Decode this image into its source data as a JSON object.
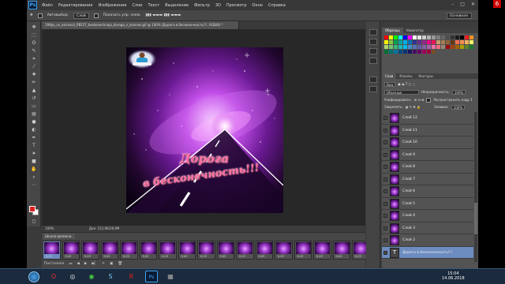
{
  "menubar": {
    "logo": "Ps",
    "items": [
      "Файл",
      "Редактирование",
      "Изображение",
      "Слои",
      "Текст",
      "Выделение",
      "Фильтр",
      "3D",
      "Просмотр",
      "Окно",
      "Справка"
    ],
    "window_controls": [
      "–",
      "□",
      "✕"
    ]
  },
  "options": {
    "autoselect_label": "Автовыбор:",
    "autoselect_value": "Слой",
    "show_controls_label": "Показать упр. элем.",
    "workspace": "Основная"
  },
  "document": {
    "tab_title": "199px_ns_animacii_PB157_beskonechnaja_doroga_v_kosmos.gif @ 100% (Дорога в бесконечность!!!, RGB/8) *",
    "status_zoom": "100%",
    "status_doc": "Док: 512,9K/26,9M"
  },
  "artwork": {
    "line1": "Дорога",
    "line2": "в бесконечность!!!"
  },
  "timeline": {
    "title": "Шкала времени",
    "frame_delay": "0,03",
    "frames": [
      1,
      2,
      3,
      4,
      5,
      6,
      7,
      8,
      9,
      10,
      11,
      12,
      13,
      14,
      15,
      16,
      17
    ],
    "selected_frame": 1,
    "loop": "Постоянно"
  },
  "right_panels": {
    "top_tabs": [
      "Образцы",
      "Навигатор"
    ],
    "layers_tabs": [
      "Слои",
      "Каналы",
      "Контуры"
    ],
    "filter_label": "Вид",
    "blend_mode": "Обычные",
    "opacity_label": "Непрозрачность:",
    "opacity_value": "100%",
    "unify_label": "Унифицировать:",
    "propagate_label": "Распространить кадр 1",
    "lock_label": "Закрепить:",
    "fill_label": "Заливка:",
    "fill_value": "100%",
    "layers": [
      {
        "name": "Слой 12",
        "type": "image"
      },
      {
        "name": "Слой 11",
        "type": "image"
      },
      {
        "name": "Слой 10",
        "type": "image"
      },
      {
        "name": "Слой 9",
        "type": "image"
      },
      {
        "name": "Слой 8",
        "type": "image"
      },
      {
        "name": "Слой 7",
        "type": "image"
      },
      {
        "name": "Слой 6",
        "type": "image"
      },
      {
        "name": "Слой 5",
        "type": "image"
      },
      {
        "name": "Слой 4",
        "type": "image"
      },
      {
        "name": "Слой 3",
        "type": "image"
      },
      {
        "name": "Слой 2",
        "type": "image"
      },
      {
        "name": "Дорога в бесконечность!!!",
        "type": "text",
        "selected": true
      }
    ]
  },
  "taskbar": {
    "time": "15:04",
    "date": "14.06.2018",
    "badge": "6"
  },
  "colors": {
    "foreground": "#e02020",
    "background": "#ffffff",
    "accent": "#6d8cc0"
  }
}
